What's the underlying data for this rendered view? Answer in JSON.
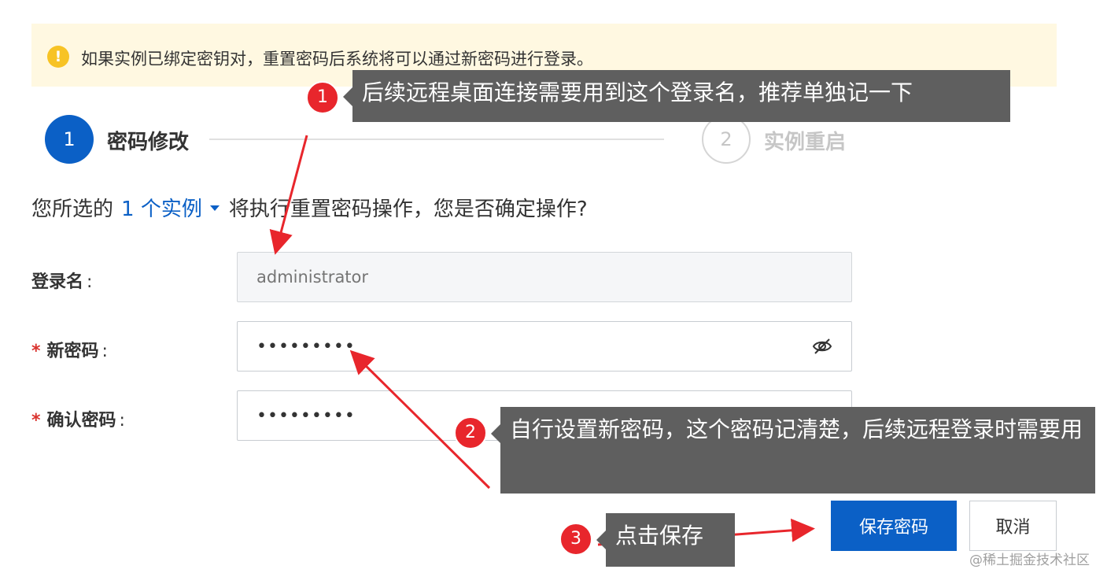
{
  "alert": {
    "text": "如果实例已绑定密钥对，重置密码后系统将可以通过新密码进行登录。"
  },
  "steps": [
    {
      "number": "1",
      "label": "密码修改"
    },
    {
      "number": "2",
      "label": "实例重启"
    }
  ],
  "selection": {
    "prefix": "您所选的",
    "count_link": "1 个实例",
    "suffix": "将执行重置密码操作，您是否确定操作?"
  },
  "form": {
    "login_name": {
      "label": "登录名",
      "colon": ":",
      "placeholder": "administrator"
    },
    "new_password": {
      "required_mark": "*",
      "label": "新密码",
      "colon": ":",
      "value": "•••••••••"
    },
    "confirm_password": {
      "required_mark": "*",
      "label": "确认密码",
      "colon": ":",
      "value": "•••••••••"
    }
  },
  "buttons": {
    "save": "保存密码",
    "cancel": "取消"
  },
  "annotations": [
    {
      "badge": "1",
      "text": "后续远程桌面连接需要用到这个登录名，推荐单独记一下"
    },
    {
      "badge": "2",
      "text": "自行设置新密码，这个密码记清楚，后续远程登录时需要用"
    },
    {
      "badge": "3",
      "text": "点击保存"
    }
  ],
  "watermark": "@稀土掘金技术社区",
  "colors": {
    "primary": "#0b60c6",
    "alert_bg": "#fff8e1",
    "alert_icon": "#f7c325",
    "required": "#d9332e",
    "annotation_red": "#e8262c",
    "callout_bg": "#5f5f5f"
  }
}
